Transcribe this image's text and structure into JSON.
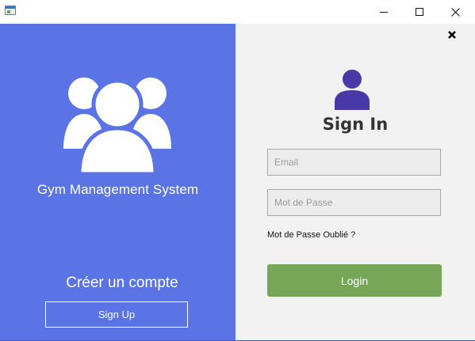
{
  "titlebar": {
    "icons": {
      "app": "app-window-icon",
      "minimize": "minimize-icon",
      "maximize": "maximize-icon",
      "close": "close-icon"
    }
  },
  "left_panel": {
    "background": "#5a74e6",
    "icon": "users-group-icon",
    "app_title": "Gym Management System",
    "create_account_label": "Créer un compte",
    "signup_label": "Sign Up"
  },
  "right_panel": {
    "background": "#f2f2f2",
    "close_icon": "close-x-icon",
    "user_icon": "user-avatar-icon",
    "user_icon_color": "#4838a8",
    "title": "Sign In",
    "email_placeholder": "Email",
    "password_placeholder": "Mot de Passe",
    "forgot_password_label": "Mot de Passe Oublié ?",
    "login_label": "Login",
    "login_color": "#77a659"
  }
}
